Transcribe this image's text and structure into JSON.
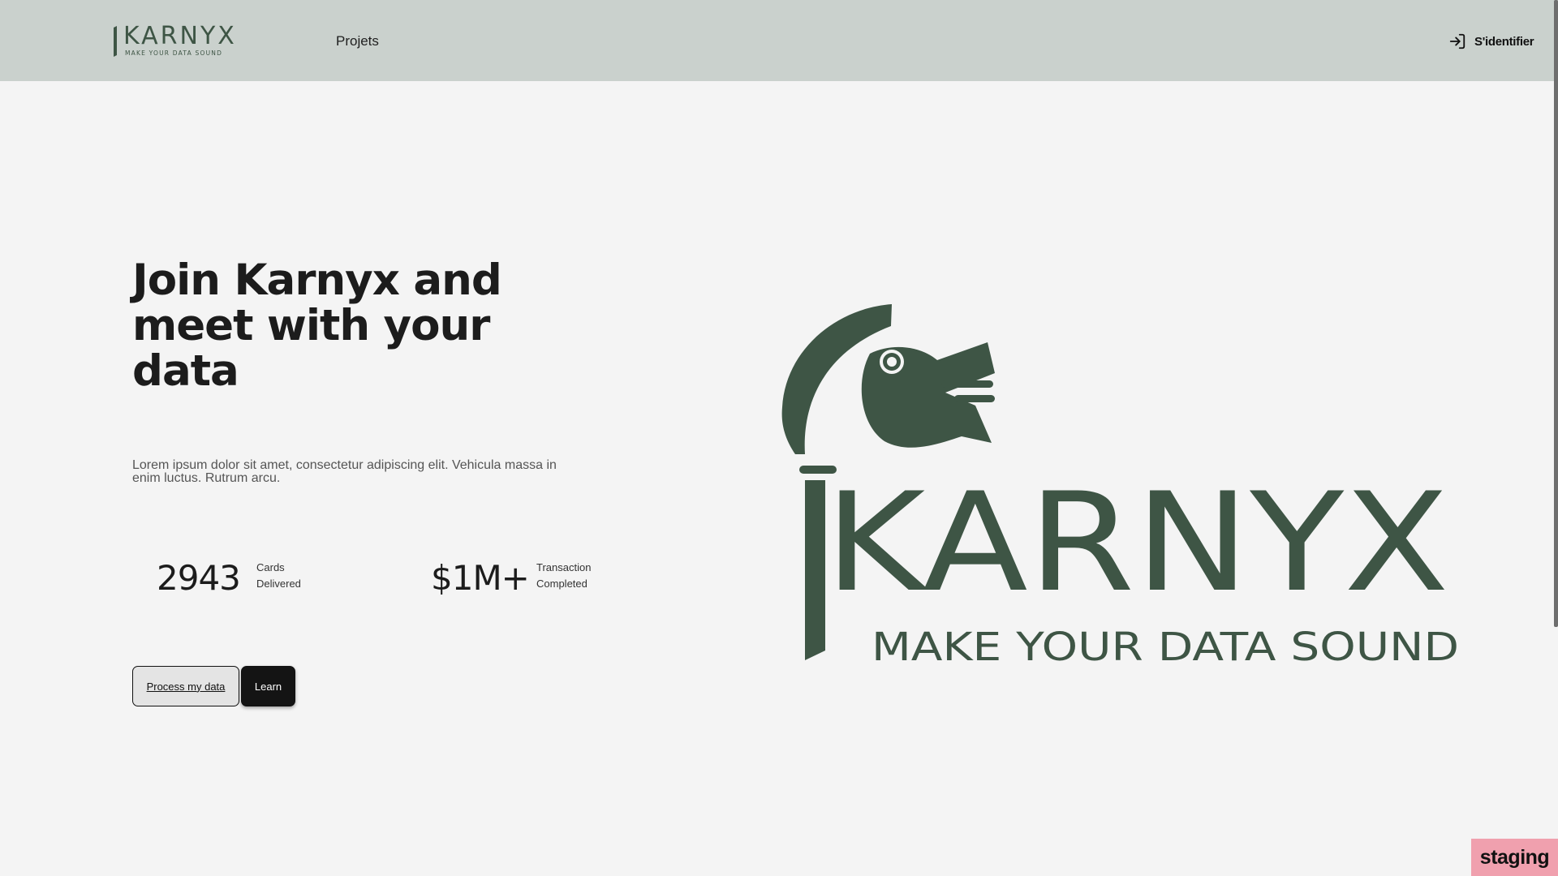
{
  "header": {
    "brand_name": "KARNYX",
    "brand_tagline": "MAKE YOUR DATA SOUND",
    "nav": [
      {
        "label": "Projets"
      }
    ],
    "login_label": "S'identifier"
  },
  "hero": {
    "title": "Join Karnyx and meet with your data",
    "description": "Lorem ipsum dolor sit amet, consectetur adipiscing elit. Vehicula massa in enim luctus. Rutrum arcu.",
    "stats": [
      {
        "value": "2943",
        "label": "Cards\nDelivered"
      },
      {
        "value": "$1M+",
        "label": "Transaction\nCompleted"
      }
    ],
    "buttons": {
      "primary": "Process my data",
      "secondary": "Learn"
    }
  },
  "big_logo": {
    "word": "KARNYX",
    "tagline": "MAKE YOUR DATA SOUND"
  },
  "env_badge": "staging",
  "colors": {
    "brand_green": "#3e5545",
    "header_bg": "#cad1cd",
    "page_bg": "#f4f4f4",
    "staging_bg": "#f0a0ae"
  }
}
